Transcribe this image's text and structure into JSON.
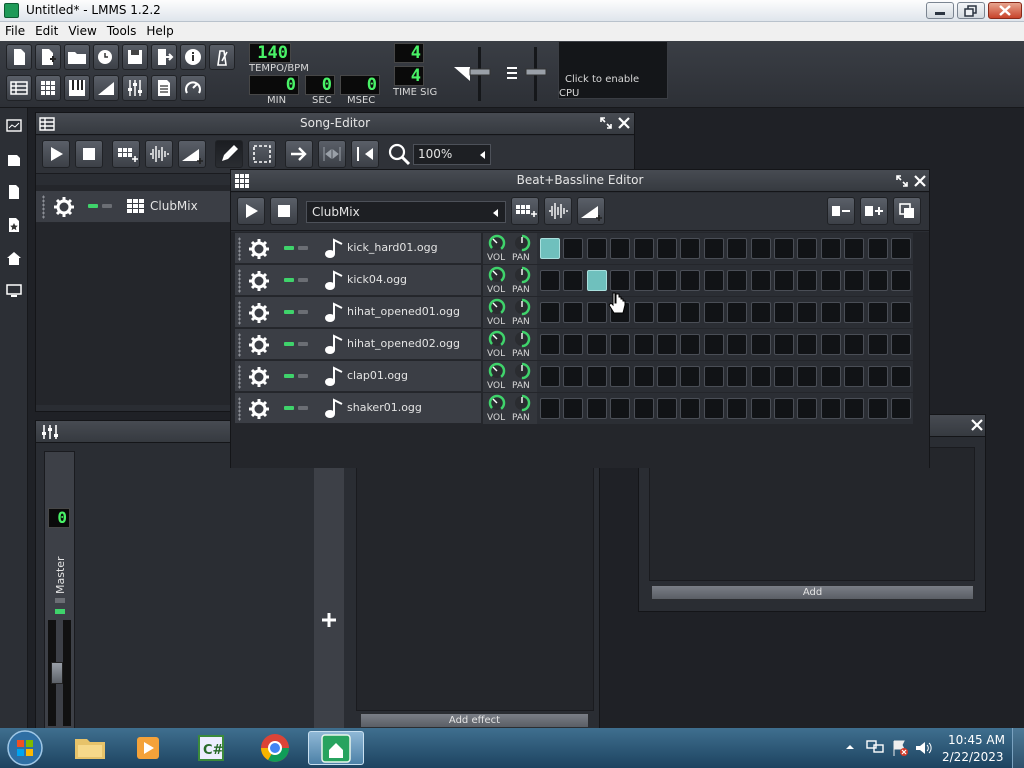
{
  "window": {
    "title": "Untitled* - LMMS 1.2.2"
  },
  "menu": [
    "File",
    "Edit",
    "View",
    "Tools",
    "Help"
  ],
  "toolbar": {
    "tempo": "140",
    "tempo_label": "TEMPO/BPM",
    "time_min": "0",
    "time_sec": "0",
    "time_msec": "0",
    "min_label": "MIN",
    "sec_label": "SEC",
    "msec_label": "MSEC",
    "timesig_num": "4",
    "timesig_den": "4",
    "timesig_label": "TIME SIG",
    "cpu_hint": "Click to enable",
    "cpu_label": "CPU"
  },
  "song_editor": {
    "title": "Song-Editor",
    "zoom": "100%",
    "track_name": "ClubMix"
  },
  "bb_editor": {
    "title": "Beat+Bassline Editor",
    "selected_pattern": "ClubMix",
    "vol_label": "VOL",
    "pan_label": "PAN",
    "tracks": [
      {
        "name": "kick_hard01.ogg",
        "steps": [
          1,
          0,
          0,
          0,
          0,
          0,
          0,
          0,
          0,
          0,
          0,
          0,
          0,
          0,
          0,
          0
        ]
      },
      {
        "name": "kick04.ogg",
        "steps": [
          0,
          0,
          1,
          0,
          0,
          0,
          0,
          0,
          0,
          0,
          0,
          0,
          0,
          0,
          0,
          0
        ]
      },
      {
        "name": "hihat_opened01.ogg",
        "steps": [
          0,
          0,
          0,
          0,
          0,
          0,
          0,
          0,
          0,
          0,
          0,
          0,
          0,
          0,
          0,
          0
        ]
      },
      {
        "name": "hihat_opened02.ogg",
        "steps": [
          0,
          0,
          0,
          0,
          0,
          0,
          0,
          0,
          0,
          0,
          0,
          0,
          0,
          0,
          0,
          0
        ]
      },
      {
        "name": "clap01.ogg",
        "steps": [
          0,
          0,
          0,
          0,
          0,
          0,
          0,
          0,
          0,
          0,
          0,
          0,
          0,
          0,
          0,
          0
        ]
      },
      {
        "name": "shaker01.ogg",
        "steps": [
          0,
          0,
          0,
          0,
          0,
          0,
          0,
          0,
          0,
          0,
          0,
          0,
          0,
          0,
          0,
          0
        ]
      }
    ]
  },
  "mixer": {
    "channel_number": "0",
    "channel_name": "Master",
    "add_effect": "Add effect"
  },
  "controller_rack": {
    "add_label": "Add"
  },
  "taskbar": {
    "time": "10:45 AM",
    "date": "2/22/2023"
  },
  "colors": {
    "lcd_green": "#49f267",
    "step_active": "#6fc0bd",
    "led_green": "#3fd36b"
  }
}
